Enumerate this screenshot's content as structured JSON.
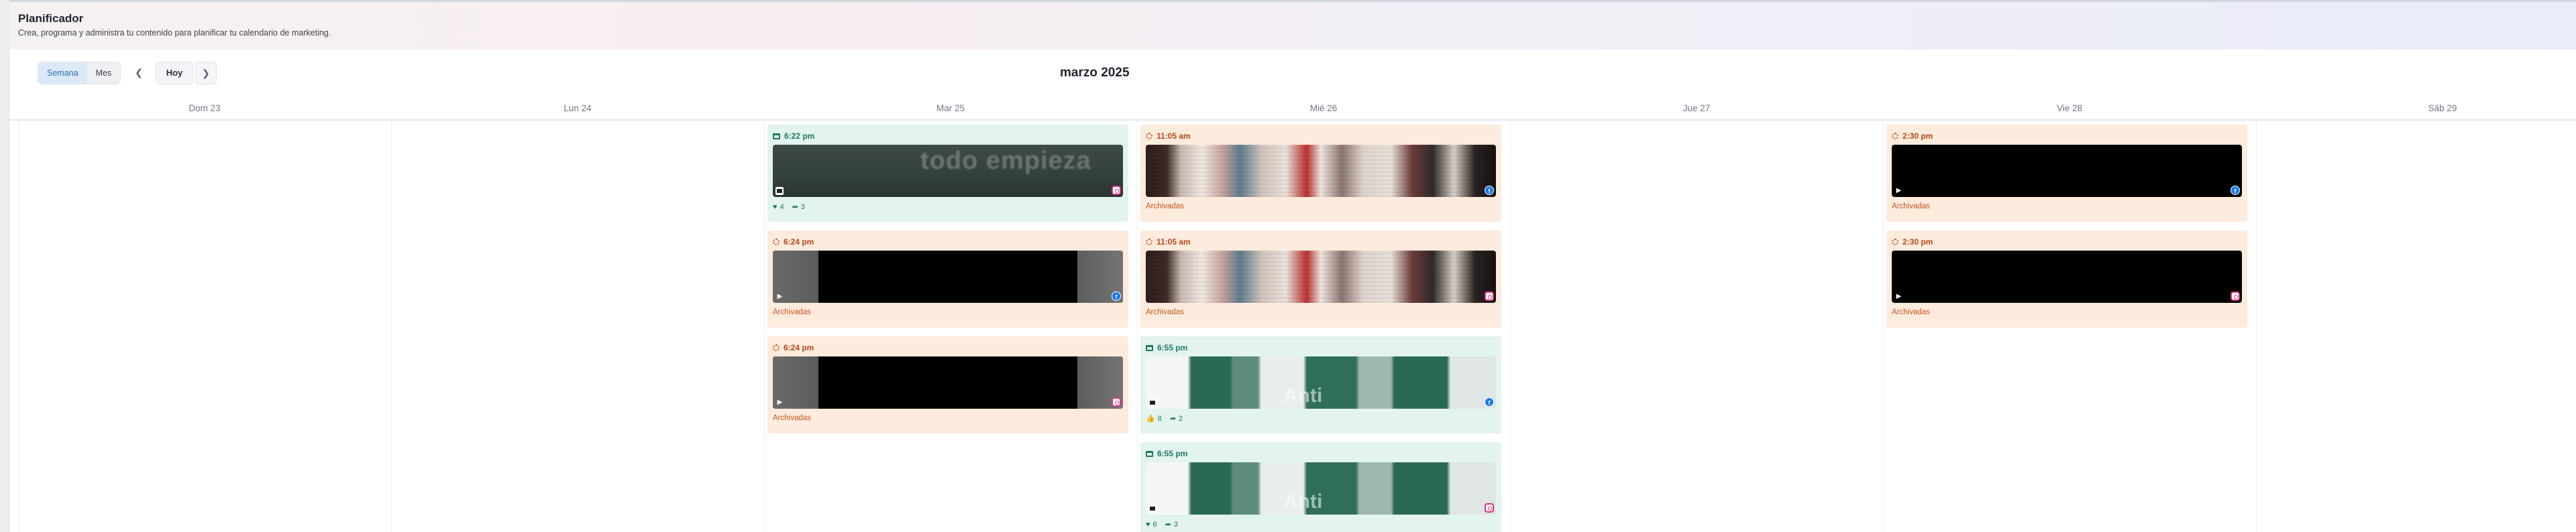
{
  "header": {
    "title": "Planificador",
    "subtitle": "Crea, programa y administra tu contenido para planificar tu calendario de marketing."
  },
  "toolbar": {
    "view_week": "Semana",
    "view_month": "Mes",
    "today": "Hoy",
    "prev_icon": "chevron-left-icon",
    "next_icon": "chevron-right-icon",
    "month_label": "marzo 2025"
  },
  "days": [
    "Dom 23",
    "Lun 24",
    "Mar 25",
    "Mié 26",
    "Jue 27",
    "Vie 28",
    "Sáb 29"
  ],
  "colors": {
    "published_bg": "#e3f3ee",
    "archived_bg": "#fdebdd",
    "published_text": "#1d7a66",
    "archived_text": "#b4481b"
  },
  "posts": {
    "tue": [
      {
        "time": "6:22 pm",
        "status": "published",
        "platform": "instagram",
        "thumb": "blurred-text",
        "thumb_text": "todo empieza",
        "likes": "4",
        "shares": "3"
      },
      {
        "time": "6:24 pm",
        "status": "Archivadas",
        "platform": "facebook",
        "thumb": "video"
      },
      {
        "time": "6:24 pm",
        "status": "Archivadas",
        "platform": "instagram",
        "thumb": "video"
      }
    ],
    "wed": [
      {
        "time": "11:05 am",
        "status": "Archivadas",
        "platform": "facebook",
        "thumb": "photo"
      },
      {
        "time": "11:05 am",
        "status": "Archivadas",
        "platform": "instagram",
        "thumb": "photo"
      },
      {
        "time": "6:55 pm",
        "status": "published",
        "platform": "facebook",
        "thumb": "tips",
        "thumb_text": "Anti",
        "likes": "8",
        "shares": "2",
        "like_icon": "thumbs-up-icon"
      },
      {
        "time": "6:55 pm",
        "status": "published",
        "platform": "instagram",
        "thumb": "tips",
        "thumb_text": "Anti",
        "likes": "6",
        "shares": "3",
        "like_icon": "heart-icon"
      }
    ],
    "fri": [
      {
        "time": "2:30 pm",
        "status": "Archivadas",
        "platform": "facebook",
        "thumb": "black"
      },
      {
        "time": "2:30 pm",
        "status": "Archivadas",
        "platform": "instagram",
        "thumb": "black"
      }
    ]
  }
}
